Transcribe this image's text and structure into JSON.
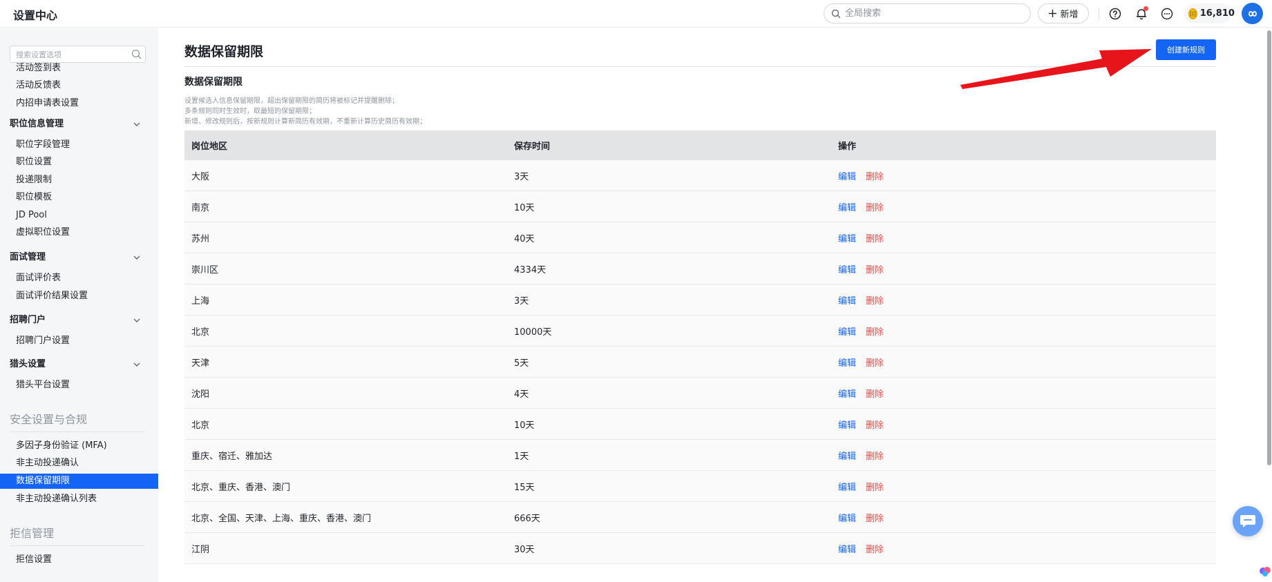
{
  "app": {
    "title": "设置中心"
  },
  "topbar": {
    "search_placeholder": "全局搜索",
    "add_label": "新增",
    "coins": "16,810",
    "icons": [
      "help-icon",
      "bell-icon",
      "more-icon"
    ]
  },
  "sidebar": {
    "search_placeholder": "搜索设置选项",
    "items_top": [
      "活动签到表",
      "活动反馈表",
      "内招申请表设置"
    ],
    "groups": [
      {
        "label": "职位信息管理",
        "items": [
          "职位字段管理",
          "职位设置",
          "投递限制",
          "职位模板",
          "JD Pool",
          "虚拟职位设置"
        ]
      },
      {
        "label": "面试管理",
        "items": [
          "面试评价表",
          "面试评价结果设置"
        ]
      },
      {
        "label": "招聘门户",
        "items": [
          "招聘门户设置"
        ]
      },
      {
        "label": "猎头设置",
        "items": [
          "猎头平台设置"
        ]
      }
    ],
    "section_security": "安全设置与合规",
    "security_items": [
      "多因子身份验证 (MFA)",
      "非主动投递确认",
      "数据保留期限",
      "非主动投递确认列表"
    ],
    "active_item": "数据保留期限",
    "section_reject": "拒信管理",
    "reject_items": [
      "拒信设置"
    ]
  },
  "main": {
    "page_title": "数据保留期限",
    "create_label": "创建新规则",
    "section_title": "数据保留期限",
    "desc": [
      "设置候选人信息保留期限，超出保留期限的简历将被标记并提醒删除；",
      "多条规则同时生效时，取最短的保留期限；",
      "新增、修改规则后，按新规则计算新简历有效期，不重新计算历史简历有效期；"
    ],
    "table": {
      "headers": [
        "岗位地区",
        "保存时间",
        "操作"
      ],
      "edit_label": "编辑",
      "delete_label": "删除",
      "rows": [
        {
          "region": "大阪",
          "duration": "3天"
        },
        {
          "region": "南京",
          "duration": "10天"
        },
        {
          "region": "苏州",
          "duration": "40天"
        },
        {
          "region": "崇川区",
          "duration": "4334天"
        },
        {
          "region": "上海",
          "duration": "3天"
        },
        {
          "region": "北京",
          "duration": "10000天"
        },
        {
          "region": "天津",
          "duration": "5天"
        },
        {
          "region": "沈阳",
          "duration": "4天"
        },
        {
          "region": "北京",
          "duration": "10天"
        },
        {
          "region": "重庆、宿迁、雅加达",
          "duration": "1天"
        },
        {
          "region": "北京、重庆、香港、澳门",
          "duration": "15天"
        },
        {
          "region": "北京、全国、天津、上海、重庆、香港、澳门",
          "duration": "666天"
        },
        {
          "region": "江阴",
          "duration": "30天"
        }
      ]
    }
  },
  "colors": {
    "accent": "#1464f5",
    "danger": "#f54a45",
    "arrow": "#e8141b"
  }
}
